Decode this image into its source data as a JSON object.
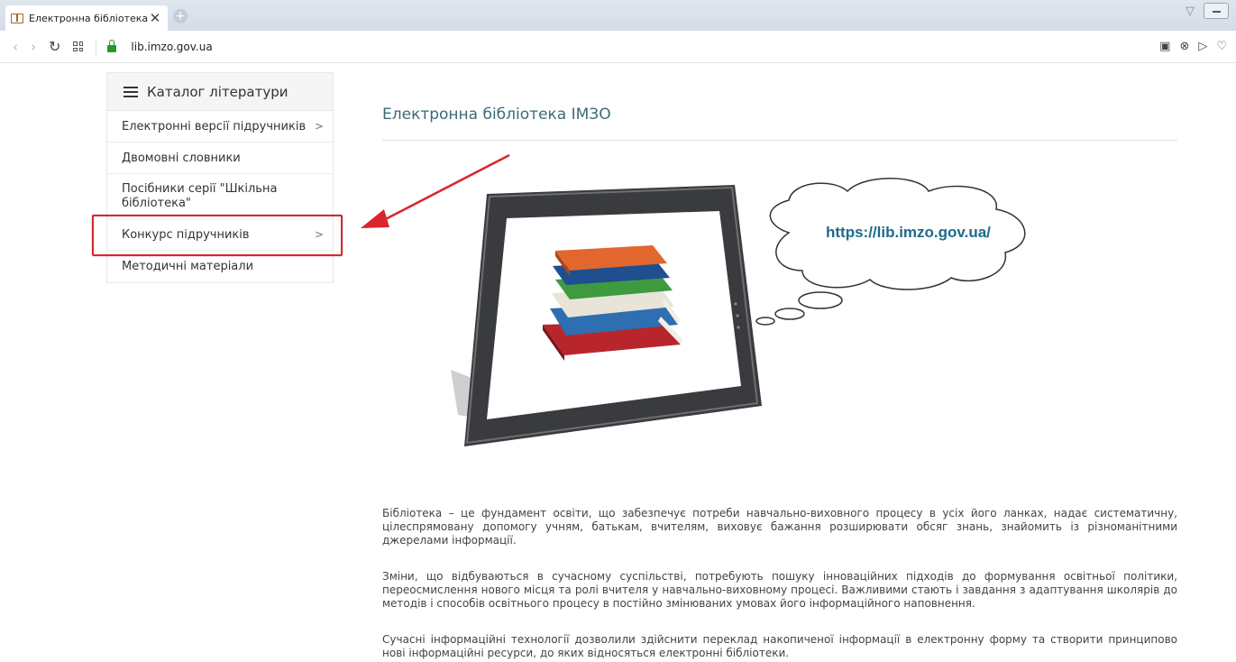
{
  "browser": {
    "tab_title": "Електронна бібліотека",
    "url": "lib.imzo.gov.ua"
  },
  "sidebar": {
    "header": "Каталог літератури",
    "items": [
      {
        "label": "Електронні версії підручників",
        "has_submenu": true
      },
      {
        "label": "Двомовні словники",
        "has_submenu": false
      },
      {
        "label": "Посібники серії \"Шкільна бібліотека\"",
        "has_submenu": false
      },
      {
        "label": "Конкурс підручників",
        "has_submenu": true
      },
      {
        "label": "Методичні матеріали",
        "has_submenu": false
      }
    ]
  },
  "main": {
    "title": "Електронна бібліотека ІМЗО",
    "cloud_url": "https://lib.imzo.gov.ua/",
    "paragraphs": [
      "Бібліотека – це фундамент освіти, що забезпечує потреби навчально-виховного процесу в усіх його ланках, надає систематичну, цілеспрямовану допомогу учням, батькам, вчителям, виховує бажання розширювати обсяг знань, знайомить із різноманітними джерелами інформації.",
      "Зміни, що відбуваються в сучасному суспільстві, потребують пошуку інноваційних підходів до формування освітньої політики, переосмислення нового місця та ролі вчителя у навчально-виховному процесі. Важливими стають і завдання з адаптування школярів до методів і способів освітнього процесу в постійно змінюваних умовах його інформаційного наповнення.",
      "Сучасні інформаційні технології дозволили здійснити переклад накопиченої інформації в електронну форму та створити принципово нові інформаційні ресурси, до яких відносяться електронні бібліотеки."
    ]
  },
  "colors": {
    "highlight": "#d9262b",
    "title": "#3a6b78",
    "cloud_text": "#1c6b8a"
  }
}
